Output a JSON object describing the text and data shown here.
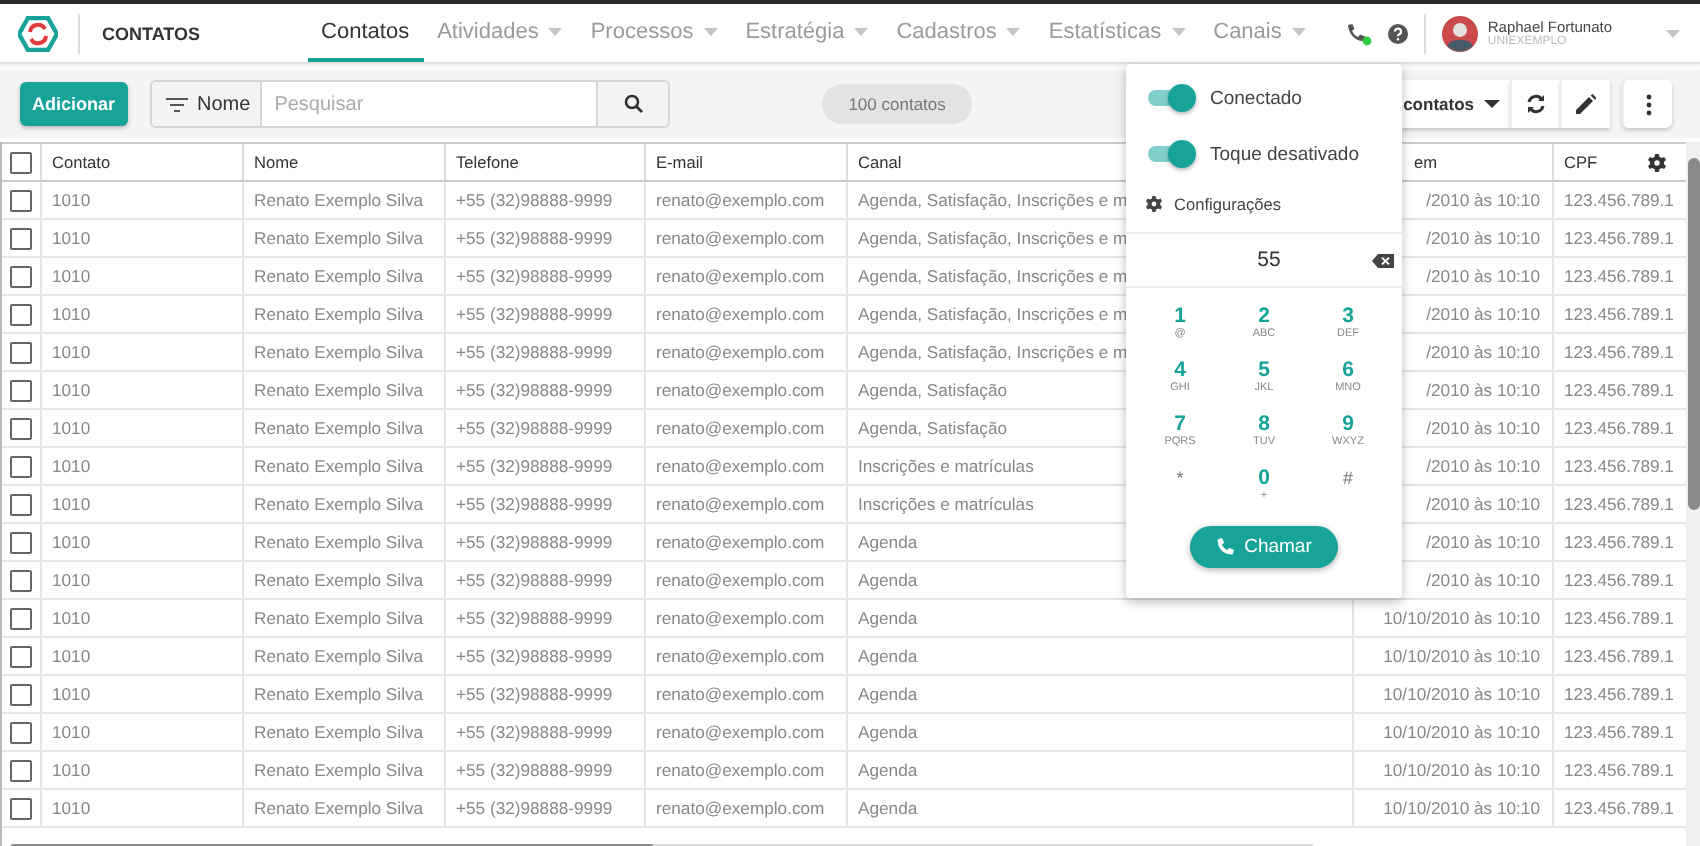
{
  "header": {
    "title": "CONTATOS",
    "nav": [
      {
        "label": "Contatos",
        "selected": true,
        "dropdown": false
      },
      {
        "label": "Atividades",
        "selected": false,
        "dropdown": true
      },
      {
        "label": "Processos",
        "selected": false,
        "dropdown": true
      },
      {
        "label": "Estratégia",
        "selected": false,
        "dropdown": true
      },
      {
        "label": "Cadastros",
        "selected": false,
        "dropdown": true
      },
      {
        "label": "Estatísticas",
        "selected": false,
        "dropdown": true
      },
      {
        "label": "Canais",
        "selected": false,
        "dropdown": true
      }
    ],
    "user": {
      "name": "Raphael Fortunato",
      "org": "UNIEXEMPLO"
    }
  },
  "toolbar": {
    "add_button": "Adicionar",
    "filter_label": "Nome",
    "search": {
      "placeholder": "Pesquisar"
    },
    "count": "100 contatos",
    "view_select": "contatos"
  },
  "table": {
    "header_checked": false,
    "columns": [
      "Contato",
      "Nome",
      "Telefone",
      "E-mail",
      "Canal",
      "em",
      "CPF"
    ],
    "rows": [
      {
        "checked": false,
        "cells": [
          "1010",
          "Renato Exemplo Silva",
          "+55 (32)98888-9999",
          "renato@exemplo.com",
          "Agenda, Satisfação, Inscrições e m",
          "/2010 às 10:10",
          "123.456.789.1"
        ]
      },
      {
        "checked": false,
        "cells": [
          "1010",
          "Renato Exemplo Silva",
          "+55 (32)98888-9999",
          "renato@exemplo.com",
          "Agenda, Satisfação, Inscrições e m",
          "/2010 às 10:10",
          "123.456.789.1"
        ]
      },
      {
        "checked": false,
        "cells": [
          "1010",
          "Renato Exemplo Silva",
          "+55 (32)98888-9999",
          "renato@exemplo.com",
          "Agenda, Satisfação, Inscrições e m",
          "/2010 às 10:10",
          "123.456.789.1"
        ]
      },
      {
        "checked": false,
        "cells": [
          "1010",
          "Renato Exemplo Silva",
          "+55 (32)98888-9999",
          "renato@exemplo.com",
          "Agenda, Satisfação, Inscrições e m",
          "/2010 às 10:10",
          "123.456.789.1"
        ]
      },
      {
        "checked": false,
        "cells": [
          "1010",
          "Renato Exemplo Silva",
          "+55 (32)98888-9999",
          "renato@exemplo.com",
          "Agenda, Satisfação, Inscrições e m",
          "/2010 às 10:10",
          "123.456.789.1"
        ]
      },
      {
        "checked": false,
        "cells": [
          "1010",
          "Renato Exemplo Silva",
          "+55 (32)98888-9999",
          "renato@exemplo.com",
          "Agenda, Satisfação",
          "/2010 às 10:10",
          "123.456.789.1"
        ]
      },
      {
        "checked": false,
        "cells": [
          "1010",
          "Renato Exemplo Silva",
          "+55 (32)98888-9999",
          "renato@exemplo.com",
          "Agenda, Satisfação",
          "/2010 às 10:10",
          "123.456.789.1"
        ]
      },
      {
        "checked": false,
        "cells": [
          "1010",
          "Renato Exemplo Silva",
          "+55 (32)98888-9999",
          "renato@exemplo.com",
          "Inscrições e matrículas",
          "/2010 às 10:10",
          "123.456.789.1"
        ]
      },
      {
        "checked": false,
        "cells": [
          "1010",
          "Renato Exemplo Silva",
          "+55 (32)98888-9999",
          "renato@exemplo.com",
          "Inscrições e matrículas",
          "/2010 às 10:10",
          "123.456.789.1"
        ]
      },
      {
        "checked": false,
        "cells": [
          "1010",
          "Renato Exemplo Silva",
          "+55 (32)98888-9999",
          "renato@exemplo.com",
          "Agenda",
          "/2010 às 10:10",
          "123.456.789.1"
        ]
      },
      {
        "checked": false,
        "cells": [
          "1010",
          "Renato Exemplo Silva",
          "+55 (32)98888-9999",
          "renato@exemplo.com",
          "Agenda",
          "/2010 às 10:10",
          "123.456.789.1"
        ]
      },
      {
        "checked": false,
        "cells": [
          "1010",
          "Renato Exemplo Silva",
          "+55 (32)98888-9999",
          "renato@exemplo.com",
          "Agenda",
          "10/10/2010 às 10:10",
          "123.456.789.1"
        ]
      },
      {
        "checked": false,
        "cells": [
          "1010",
          "Renato Exemplo Silva",
          "+55 (32)98888-9999",
          "renato@exemplo.com",
          "Agenda",
          "10/10/2010 às 10:10",
          "123.456.789.1"
        ]
      },
      {
        "checked": false,
        "cells": [
          "1010",
          "Renato Exemplo Silva",
          "+55 (32)98888-9999",
          "renato@exemplo.com",
          "Agenda",
          "10/10/2010 às 10:10",
          "123.456.789.1"
        ]
      },
      {
        "checked": false,
        "cells": [
          "1010",
          "Renato Exemplo Silva",
          "+55 (32)98888-9999",
          "renato@exemplo.com",
          "Agenda",
          "10/10/2010 às 10:10",
          "123.456.789.1"
        ]
      },
      {
        "checked": false,
        "cells": [
          "1010",
          "Renato Exemplo Silva",
          "+55 (32)98888-9999",
          "renato@exemplo.com",
          "Agenda",
          "10/10/2010 às 10:10",
          "123.456.789.1"
        ]
      },
      {
        "checked": false,
        "cells": [
          "1010",
          "Renato Exemplo Silva",
          "+55 (32)98888-9999",
          "renato@exemplo.com",
          "Agenda",
          "10/10/2010 às 10:10",
          "123.456.789.1"
        ]
      }
    ]
  },
  "dialer": {
    "toggles": [
      {
        "label": "Conectado",
        "on": true
      },
      {
        "label": "Toque desativado",
        "on": true
      }
    ],
    "settings": "Configurações",
    "number": "55",
    "keys": [
      {
        "kind": "digit",
        "symbol": "1",
        "letters": "@"
      },
      {
        "kind": "digit",
        "symbol": "2",
        "letters": "ABC"
      },
      {
        "kind": "digit",
        "symbol": "3",
        "letters": "DEF"
      },
      {
        "kind": "digit",
        "symbol": "4",
        "letters": "GHI"
      },
      {
        "kind": "digit",
        "symbol": "5",
        "letters": "JKL"
      },
      {
        "kind": "digit",
        "symbol": "6",
        "letters": "MNO"
      },
      {
        "kind": "digit",
        "symbol": "7",
        "letters": "PQRS"
      },
      {
        "kind": "digit",
        "symbol": "8",
        "letters": "TUV"
      },
      {
        "kind": "digit",
        "symbol": "9",
        "letters": "WXYZ"
      },
      {
        "kind": "sign",
        "symbol": "*"
      },
      {
        "kind": "digit",
        "symbol": "0",
        "letters": "+"
      },
      {
        "kind": "sign",
        "symbol": "#"
      }
    ],
    "call_button": "Chamar"
  }
}
